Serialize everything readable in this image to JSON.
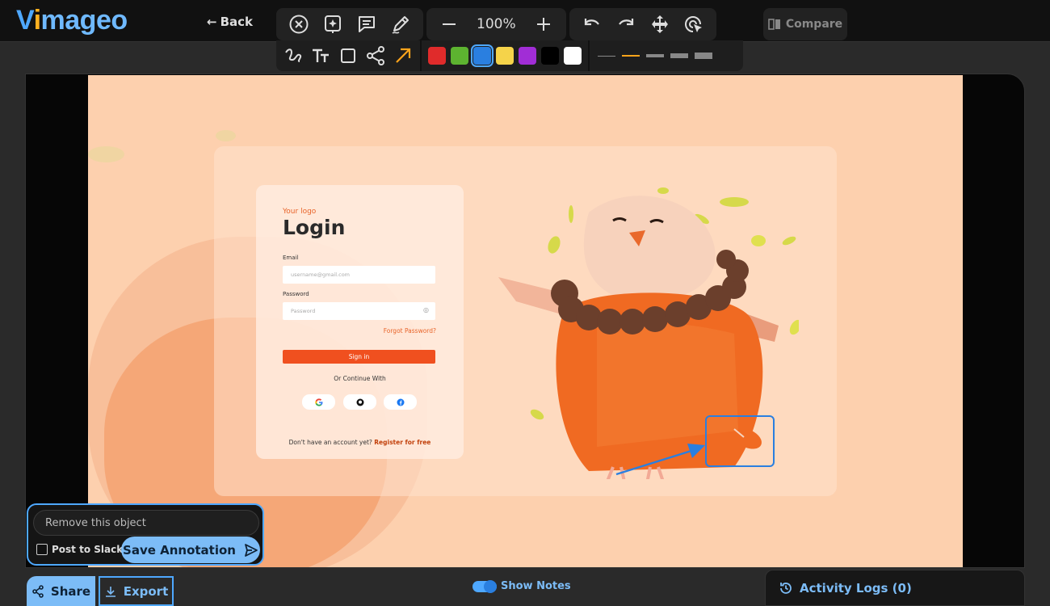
{
  "app": {
    "logo": {
      "v": "V",
      "i": "i",
      "rest": "mageo"
    },
    "back_label": "Back",
    "compare_label": "Compare"
  },
  "toolbar": {
    "zoom": "100%",
    "tools_row1": [
      "close-circle-icon",
      "magic-add-icon",
      "comment-icon",
      "pen-edit-icon"
    ],
    "tools_row1_right": [
      "undo-icon",
      "redo-icon",
      "move-icon",
      "pointer-click-icon"
    ],
    "shape_tools": [
      "freehand-icon",
      "text-icon",
      "rectangle-icon",
      "connector-icon",
      "arrow-icon"
    ],
    "colors": [
      "#e02b2b",
      "#5db330",
      "#2a7fe0",
      "#f5d34a",
      "#a12dd6",
      "#000000",
      "#ffffff"
    ],
    "selected_color": "#2a7fe0",
    "stroke_widths": [
      "thin",
      "medium",
      "thick",
      "thicker",
      "thickest"
    ],
    "selected_width": "medium"
  },
  "screenshot": {
    "logo_text": "Your logo",
    "title": "Login",
    "email_label": "Email",
    "email_placeholder": "username@gmail.com",
    "password_label": "Password",
    "password_placeholder": "Password",
    "forgot": "Forgot Password?",
    "signin": "Sign in",
    "or_continue": "Or Continue With",
    "no_account": "Don't have an account yet?",
    "register": "Register for free"
  },
  "note": {
    "text": "Remove this object",
    "post_to_slack": "Post to Slack",
    "save_label": "Save Annotation"
  },
  "bottom": {
    "share": "Share",
    "export": "Export",
    "show_notes": "Show Notes",
    "activity_logs": "Activity Logs (0)"
  }
}
